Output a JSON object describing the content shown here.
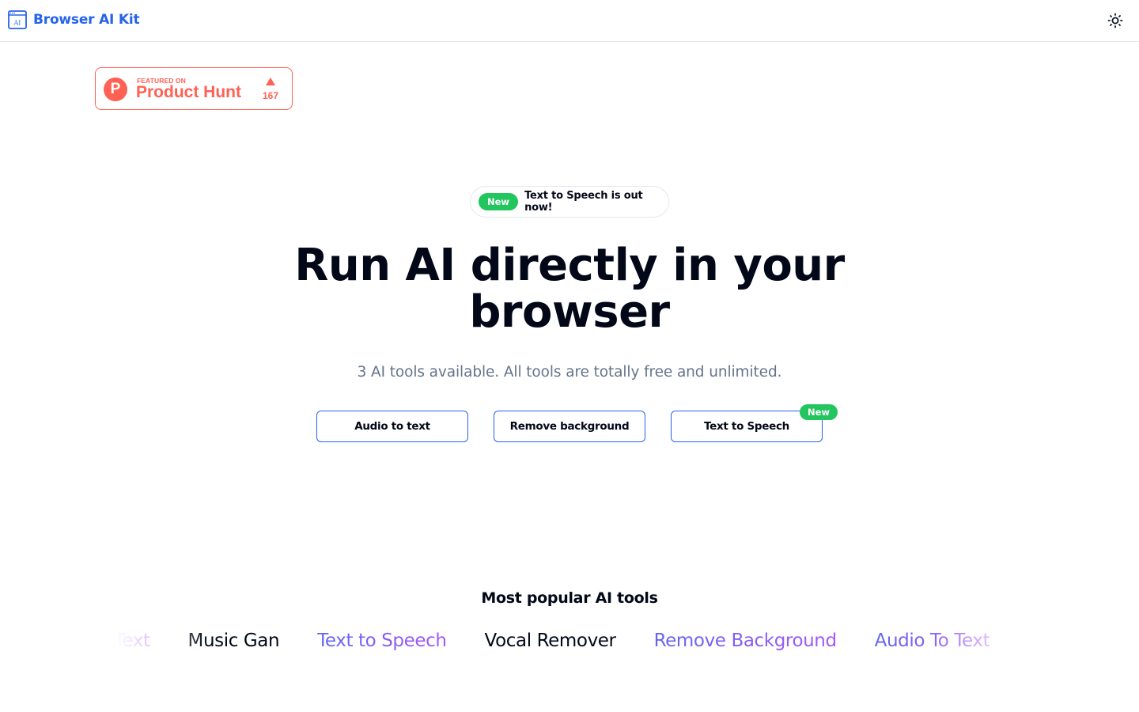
{
  "header": {
    "logo_icon": "ai-window-icon",
    "logo_icon_text": "AI",
    "brand": "Browser AI Kit",
    "theme_toggle_icon": "sun-icon"
  },
  "product_hunt": {
    "featured_label": "FEATURED ON",
    "name": "Product Hunt",
    "logo_letter": "P",
    "upvote_icon": "triangle-up-icon",
    "upvotes": "167"
  },
  "announcement": {
    "badge": "New",
    "text": "Text to Speech is out now!"
  },
  "hero": {
    "title": "Run AI directly in your browser",
    "subtitle": "3 AI tools available. All tools are totally free and unlimited."
  },
  "tool_buttons": [
    {
      "label": "Audio to text"
    },
    {
      "label": "Remove background"
    },
    {
      "label": "Text to Speech",
      "badge": "New"
    }
  ],
  "popular": {
    "title": "Most popular AI tools",
    "items": [
      {
        "label": "Audio To Text",
        "style": "gradient"
      },
      {
        "label": "Music Gan",
        "style": "dark"
      },
      {
        "label": "Text to Speech",
        "style": "gradient"
      },
      {
        "label": "Vocal Remover",
        "style": "dark"
      },
      {
        "label": "Remove Background",
        "style": "gradient"
      },
      {
        "label": "Audio To Text",
        "style": "gradient"
      }
    ]
  },
  "colors": {
    "brand": "#2563eb",
    "product_hunt": "#ff6154",
    "new_badge": "#22c55e",
    "gradient_start": "#6366f1",
    "gradient_end": "#a855f7",
    "text_primary": "#020817",
    "text_muted": "#64748b"
  }
}
